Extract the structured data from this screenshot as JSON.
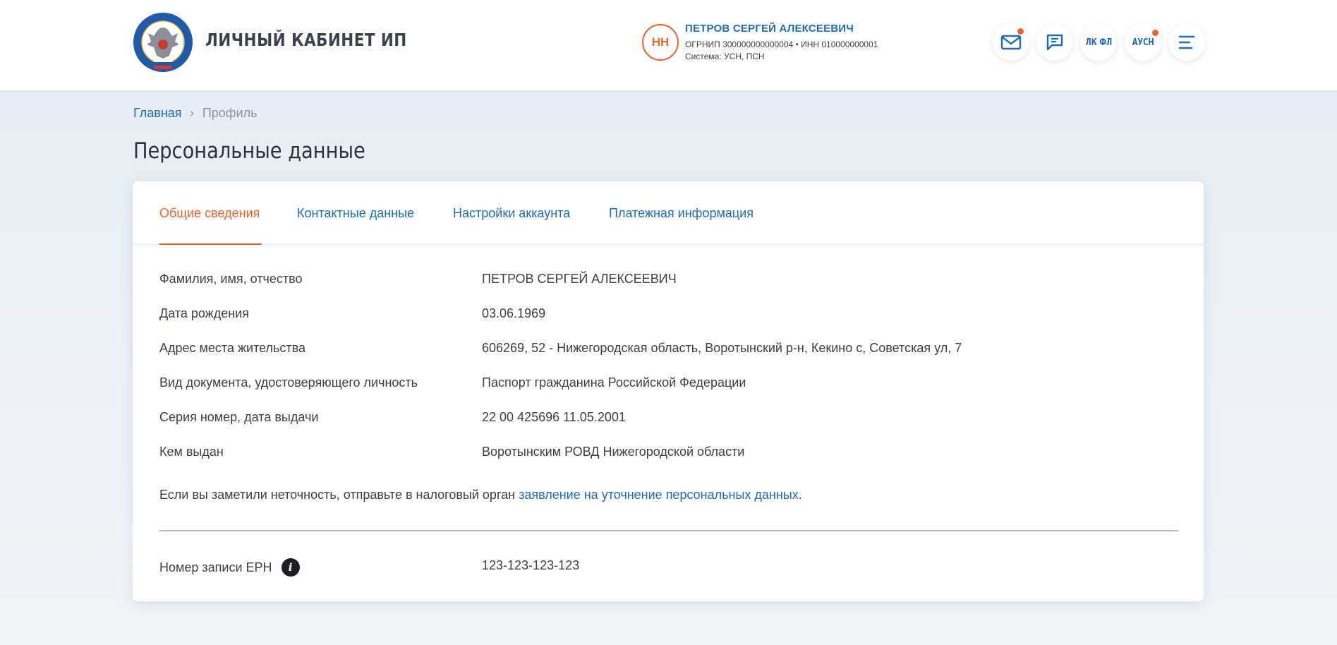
{
  "header": {
    "app_title": "ЛИЧНЫЙ КАБИНЕТ ИП",
    "user": {
      "initials": "НН",
      "name": "ПЕТРОВ СЕРГЕЙ АЛЕКСЕЕВИЧ",
      "ids": "ОГРНИП 300000000000004 • ИНН 010000000001",
      "system": "Система: УСН, ПСН"
    },
    "buttons": {
      "lk_fl": "ЛК ФЛ",
      "ausn": "АУСН"
    },
    "colors": {
      "accent": "#e8642d",
      "link": "#1f6bb5"
    }
  },
  "breadcrumb": {
    "home": "Главная",
    "separator": "›",
    "current": "Профиль"
  },
  "page": {
    "title": "Персональные данные"
  },
  "tabs": [
    {
      "label": "Общие сведения",
      "active": true
    },
    {
      "label": "Контактные данные",
      "active": false
    },
    {
      "label": "Настройки аккаунта",
      "active": false
    },
    {
      "label": "Платежная информация",
      "active": false
    }
  ],
  "details": [
    {
      "label": "Фамилия, имя, отчество",
      "value": "ПЕТРОВ СЕРГЕЙ АЛЕКСЕЕВИЧ"
    },
    {
      "label": "Дата рождения",
      "value": "03.06.1969"
    },
    {
      "label": "Адрес места жительства",
      "value": "606269, 52 - Нижегородская область, Воротынский р-н, Кекино с, Советская ул, 7"
    },
    {
      "label": "Вид документа, удостоверяющего личность",
      "value": "Паспорт гражданина Российской Федерации"
    },
    {
      "label": "Серия номер, дата выдачи",
      "value": "22 00 425696 11.05.2001"
    },
    {
      "label": "Кем выдан",
      "value": "Воротынским РОВД Нижегородской области"
    }
  ],
  "note": {
    "text": "Если вы заметили неточность, отправьте в налоговый орган ",
    "link": "заявление на уточнение персональных данных",
    "end": "."
  },
  "ern": {
    "label": "Номер записи ЕРН",
    "info_glyph": "i",
    "value": "123-123-123-123"
  }
}
